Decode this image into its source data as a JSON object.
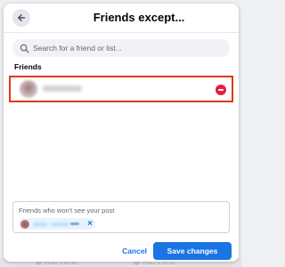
{
  "dialog": {
    "title": "Friends except...",
    "back_icon": "arrow-left-icon"
  },
  "search": {
    "placeholder": "Search for a friend or list...",
    "icon": "search-icon"
  },
  "friends": {
    "section_label": "Friends",
    "rows": [
      {
        "name": "",
        "selected": true,
        "action_icon": "remove-circle-icon"
      }
    ]
  },
  "excluded": {
    "hint": "Friends who won't see your post",
    "chips": [
      {
        "name": "",
        "remove_label": "×"
      }
    ]
  },
  "actions": {
    "cancel_label": "Cancel",
    "save_label": "Save changes"
  },
  "background": {
    "ghost_labels": [
      "Add friend",
      "Add friend"
    ]
  },
  "colors": {
    "accent": "#1b74e4",
    "highlight_border": "#e2361d",
    "remove": "#e41e3f"
  }
}
